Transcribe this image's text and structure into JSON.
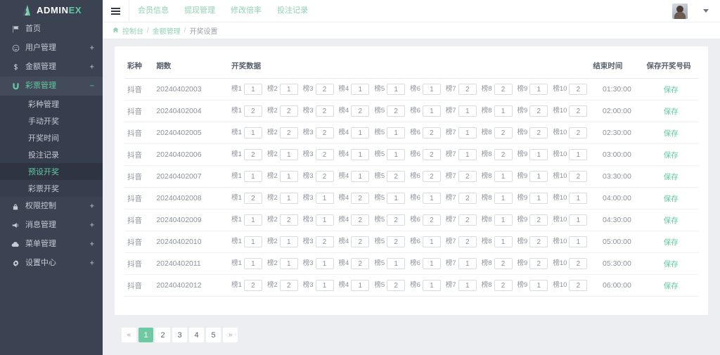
{
  "brand": {
    "name_primary": "ADMIN",
    "name_accent": "EX",
    "logo_icon": "mountain-logo-icon"
  },
  "sidebar": {
    "items": [
      {
        "label": "首页",
        "icon": "flag-icon",
        "expander": ""
      },
      {
        "label": "用户管理",
        "icon": "user-circle-icon",
        "expander": "+"
      },
      {
        "label": "金额管理",
        "icon": "dollar-sign-icon",
        "expander": "+"
      },
      {
        "label": "彩票管理",
        "icon": "magnet-icon",
        "expander": "−"
      }
    ],
    "submenu": [
      {
        "label": "彩种管理",
        "active": false
      },
      {
        "label": "手动开奖",
        "active": false
      },
      {
        "label": "开奖时间",
        "active": false
      },
      {
        "label": "投注记录",
        "active": false
      },
      {
        "label": "预设开奖",
        "active": true
      },
      {
        "label": "彩票开奖",
        "active": false
      }
    ],
    "items_bottom": [
      {
        "label": "权限控制",
        "icon": "lock-icon",
        "expander": "+"
      },
      {
        "label": "消息管理",
        "icon": "bullhorn-icon",
        "expander": "+"
      },
      {
        "label": "菜单管理",
        "icon": "cloud-icon",
        "expander": "+"
      },
      {
        "label": "设置中心",
        "icon": "gear-icon",
        "expander": "+"
      }
    ]
  },
  "topbar": {
    "menu_icon": "hamburger-icon",
    "nav": [
      {
        "label": "会员信息"
      },
      {
        "label": "提现管理"
      },
      {
        "label": "修改倍率"
      },
      {
        "label": "投注记录"
      }
    ],
    "avatar_icon": "user-avatar",
    "caret_icon": "chevron-down-icon"
  },
  "breadcrumb": {
    "home_icon": "home-icon",
    "items": [
      "控制台",
      "金额管理",
      "开奖设置"
    ],
    "separator": "/"
  },
  "table": {
    "headers": {
      "type": "彩种",
      "period": "期数",
      "data": "开奖数据",
      "end_time": "结束时间",
      "save": "保存开奖号码"
    },
    "ball_label_prefix": "榜",
    "save_label": "保存",
    "rows": [
      {
        "type": "抖音",
        "period": "20240402003",
        "values": [
          "1",
          "1",
          "2",
          "1",
          "1",
          "1",
          "2",
          "2",
          "1",
          "2"
        ],
        "end_time": "01:30:00"
      },
      {
        "type": "抖音",
        "period": "20240402004",
        "values": [
          "2",
          "2",
          "2",
          "2",
          "2",
          "1",
          "1",
          "1",
          "2",
          "2"
        ],
        "end_time": "02:00:00"
      },
      {
        "type": "抖音",
        "period": "20240402005",
        "values": [
          "1",
          "2",
          "2",
          "1",
          "1",
          "2",
          "1",
          "2",
          "2",
          "2"
        ],
        "end_time": "02:30:00"
      },
      {
        "type": "抖音",
        "period": "20240402006",
        "values": [
          "2",
          "1",
          "2",
          "1",
          "1",
          "2",
          "1",
          "2",
          "1",
          "1"
        ],
        "end_time": "03:00:00"
      },
      {
        "type": "抖音",
        "period": "20240402007",
        "values": [
          "1",
          "1",
          "2",
          "1",
          "2",
          "2",
          "2",
          "1",
          "1",
          "2"
        ],
        "end_time": "03:30:00"
      },
      {
        "type": "抖音",
        "period": "20240402008",
        "values": [
          "2",
          "1",
          "1",
          "2",
          "1",
          "1",
          "2",
          "1",
          "1",
          "1"
        ],
        "end_time": "04:00:00"
      },
      {
        "type": "抖音",
        "period": "20240402009",
        "values": [
          "1",
          "2",
          "1",
          "2",
          "2",
          "2",
          "2",
          "1",
          "2",
          "1"
        ],
        "end_time": "04:30:00"
      },
      {
        "type": "抖音",
        "period": "20240402010",
        "values": [
          "1",
          "1",
          "2",
          "2",
          "2",
          "1",
          "2",
          "1",
          "2",
          "1"
        ],
        "end_time": "05:00:00"
      },
      {
        "type": "抖音",
        "period": "20240402011",
        "values": [
          "1",
          "1",
          "1",
          "2",
          "1",
          "1",
          "1",
          "2",
          "2",
          "2"
        ],
        "end_time": "05:30:00"
      },
      {
        "type": "抖音",
        "period": "20240402012",
        "values": [
          "2",
          "2",
          "1",
          "1",
          "2",
          "1",
          "1",
          "2",
          "1",
          "2"
        ],
        "end_time": "06:00:00"
      }
    ]
  },
  "pagination": {
    "prev": "«",
    "next": "»",
    "pages": [
      "1",
      "2",
      "3",
      "4",
      "5"
    ],
    "active": "1"
  },
  "colors": {
    "sidebar_bg": "#3b4252",
    "submenu_bg": "#363d4c",
    "accent_green": "#61c9a0",
    "page_bg": "#eceef1"
  }
}
